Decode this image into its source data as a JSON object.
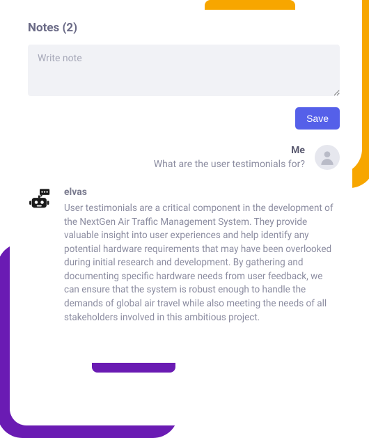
{
  "notes": {
    "title": "Notes (2)",
    "placeholder": "Write note",
    "save": "Save"
  },
  "thread": {
    "me": {
      "name": "Me",
      "text": "What are the user testimonials for?"
    },
    "bot": {
      "name": "elvas",
      "text": "User testimonials are a critical component in the development of the NextGen Air Traffic Management System. They provide valuable insight into user experiences and help identify any potential hardware requirements that may have been overlooked during initial research and development. By gathering and documenting specific hardware needs from user feedback, we can ensure that the system is robust enough to handle the demands of global air travel while also meeting the needs of all stakeholders involved in this ambitious project."
    }
  }
}
